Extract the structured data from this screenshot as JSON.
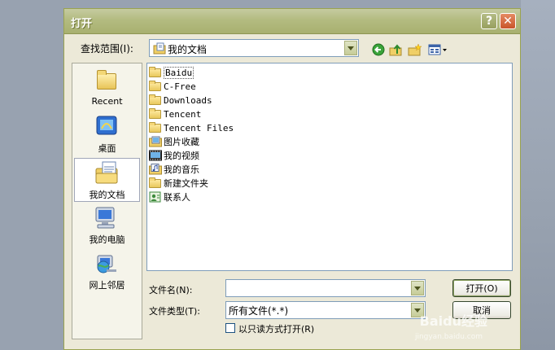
{
  "window": {
    "title": "打开",
    "help_symbol": "?",
    "close_symbol": "✕"
  },
  "lookin": {
    "label": "查找范围(I):",
    "value": "我的文档"
  },
  "places": [
    {
      "label": "Recent"
    },
    {
      "label": "桌面"
    },
    {
      "label": "我的文档"
    },
    {
      "label": "我的电脑"
    },
    {
      "label": "网上邻居"
    }
  ],
  "files": [
    {
      "name": "Baidu",
      "icon": "folder-icon"
    },
    {
      "name": "C-Free",
      "icon": "folder-icon"
    },
    {
      "name": "Downloads",
      "icon": "folder-icon"
    },
    {
      "name": "Tencent",
      "icon": "folder-icon"
    },
    {
      "name": "Tencent Files",
      "icon": "folder-icon"
    },
    {
      "name": "图片收藏",
      "icon": "pictures-folder-icon"
    },
    {
      "name": "我的视频",
      "icon": "video-folder-icon"
    },
    {
      "name": "我的音乐",
      "icon": "music-folder-icon"
    },
    {
      "name": "新建文件夹",
      "icon": "folder-icon"
    },
    {
      "name": "联系人",
      "icon": "contacts-icon"
    }
  ],
  "filename": {
    "label": "文件名(N):",
    "value": ""
  },
  "filetype": {
    "label": "文件类型(T):",
    "value": "所有文件(*.*)"
  },
  "readonly_label": "以只读方式打开(R)",
  "buttons": {
    "open": "打开(O)",
    "cancel": "取消"
  },
  "watermark": {
    "brand": "Baidu经验",
    "url": "jingyan.baidu.com"
  }
}
